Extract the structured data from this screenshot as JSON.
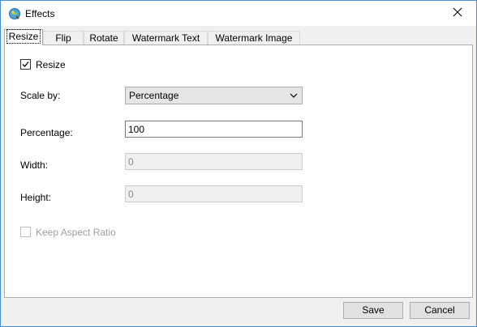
{
  "window": {
    "title": "Effects",
    "icons": {
      "app": "effects-app-icon",
      "close": "close-icon"
    }
  },
  "tabs": [
    {
      "label": "Resize",
      "active": true
    },
    {
      "label": "Flip",
      "active": false
    },
    {
      "label": "Rotate",
      "active": false
    },
    {
      "label": "Watermark Text",
      "active": false
    },
    {
      "label": "Watermark Image",
      "active": false
    }
  ],
  "resize": {
    "enable_label": "Resize",
    "enable_checked": true,
    "scale_by_label": "Scale by:",
    "scale_by_value": "Percentage",
    "percentage_label": "Percentage:",
    "percentage_value": "100",
    "width_label": "Width:",
    "width_value": "0",
    "height_label": "Height:",
    "height_value": "0",
    "keep_aspect_label": "Keep Aspect Ratio",
    "keep_aspect_checked": false
  },
  "buttons": {
    "save": "Save",
    "cancel": "Cancel"
  },
  "colors": {
    "window_border": "#4a8ad8",
    "panel_bg": "#ffffff",
    "dialog_bg": "#f0f0f0"
  }
}
